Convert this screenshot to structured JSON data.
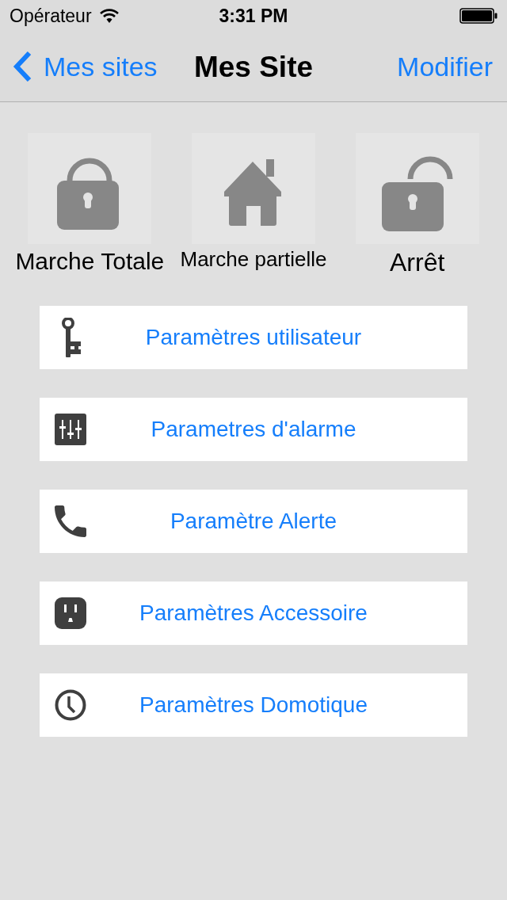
{
  "status_bar": {
    "carrier": "Opérateur",
    "time": "3:31 PM"
  },
  "nav_bar": {
    "back": "Mes sites",
    "title": "Mes Site",
    "action": "Modifier"
  },
  "modes": [
    {
      "kind": "lock",
      "label": "Marche Totale"
    },
    {
      "kind": "home",
      "label": "Marche partielle"
    },
    {
      "kind": "unlock",
      "label": "Arrêt"
    }
  ],
  "menu": [
    {
      "kind": "key",
      "label": "Paramètres utilisateur"
    },
    {
      "kind": "sliders",
      "label": "Parametres d'alarme"
    },
    {
      "kind": "phone",
      "label": "Paramètre Alerte"
    },
    {
      "kind": "outlet",
      "label": "Paramètres Accessoire"
    },
    {
      "kind": "clock",
      "label": "Paramètres Domotique"
    }
  ]
}
